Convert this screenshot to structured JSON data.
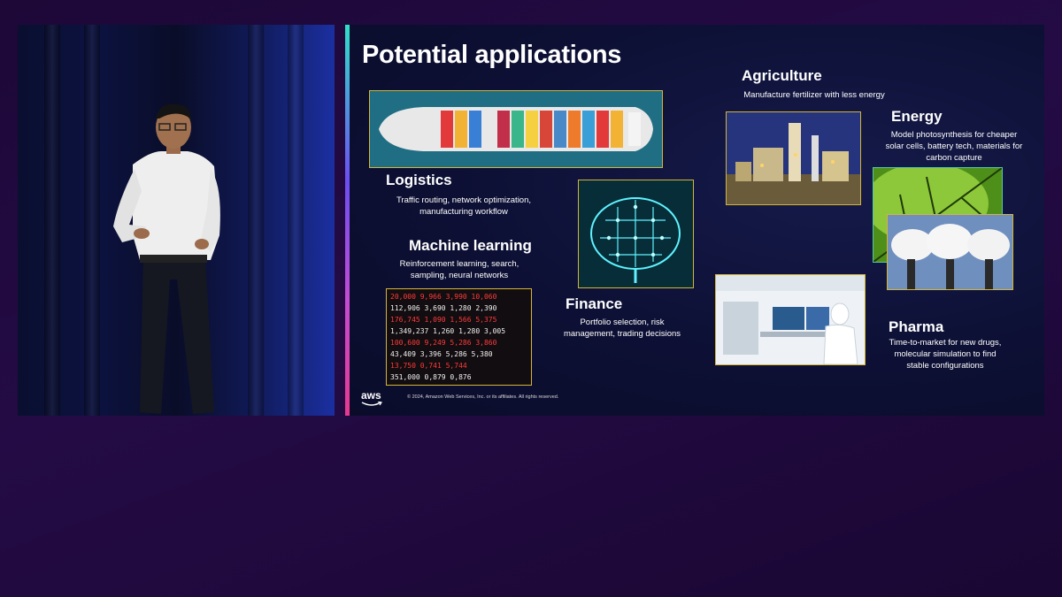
{
  "slide": {
    "title": "Potential applications",
    "sections": {
      "logistics": {
        "heading": "Logistics",
        "desc_line1": "Traffic routing, network optimization,",
        "desc_line2": "manufacturing workflow"
      },
      "machine_learning": {
        "heading": "Machine learning",
        "desc_line1": "Reinforcement learning, search,",
        "desc_line2": "sampling, neural networks"
      },
      "finance": {
        "heading": "Finance",
        "desc_line1": "Portfolio selection, risk",
        "desc_line2": "management, trading decisions"
      },
      "agriculture": {
        "heading": "Agriculture",
        "desc_line1": "Manufacture fertilizer with less energy"
      },
      "energy": {
        "heading": "Energy",
        "desc_line1": "Model photosynthesis for cheaper",
        "desc_line2": "solar cells, battery tech, materials for",
        "desc_line3": "carbon capture"
      },
      "pharma": {
        "heading": "Pharma",
        "desc_line1": "Time-to-market for new drugs,",
        "desc_line2": "molecular simulation to find",
        "desc_line3": "stable configurations"
      }
    },
    "ticker_rows": [
      "20,000   9,966   3,990  10,060",
      "112,906  3,690  1,280  2,390",
      "176,745  1,090  1,566  5,375",
      "1,349,237  1,260  1,280  3,005",
      "100,600   9,249  5,286  3,860",
      "43,409   3,396  5,286  5,380",
      "13,750   0,741  5,744",
      "351,000  0,879  0,876"
    ],
    "logo_text": "aws",
    "copyright": "© 2024, Amazon Web Services, Inc. or its affiliates. All rights reserved."
  },
  "colors": {
    "background": "#1f0a3c",
    "slide_bg": "#0d1034",
    "photo_border": "#d4b43a",
    "accent_teal": "#2fe0c8",
    "accent_pink": "#e8388f",
    "ticker_red": "#ff3b3b",
    "ticker_white": "#f2f2f2"
  }
}
